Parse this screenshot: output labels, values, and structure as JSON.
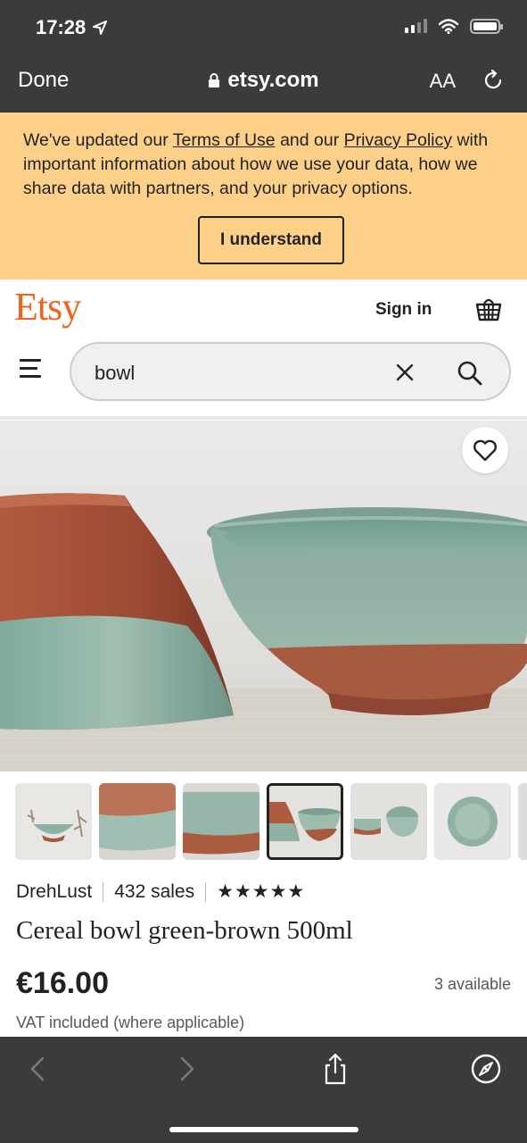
{
  "status_bar": {
    "time": "17:28"
  },
  "browser": {
    "done_label": "Done",
    "url": "etsy.com",
    "text_size_label": "AA",
    "colors": {
      "chrome": "#3b3b3d"
    }
  },
  "banner": {
    "text_before_terms": "We've updated our ",
    "terms_link": "Terms of Use",
    "text_between": " and our ",
    "privacy_link": "Privacy Policy",
    "text_after": " with important information about how we use your data, how we share data with partners, and your privacy options.",
    "button_label": "I understand",
    "colors": {
      "background": "#fdd08a"
    }
  },
  "header": {
    "logo": "Etsy",
    "sign_in_label": "Sign in",
    "colors": {
      "brand": "#f1641e"
    }
  },
  "search": {
    "value": "bowl"
  },
  "gallery": {
    "thumbnail_count": 6,
    "active_index": 3
  },
  "product": {
    "shop_name": "DrehLust",
    "sales": "432 sales",
    "rating_stars": "★★★★★",
    "rating": 5,
    "title": "Cereal bowl green-brown 500ml",
    "price": "€16.00",
    "availability": "3 available",
    "vat_note": "VAT included (where applicable)"
  },
  "icons": {
    "location": "location-arrow-icon",
    "lock": "lock-icon",
    "reload": "reload-icon",
    "basket": "basket-icon",
    "menu": "hamburger-menu-icon",
    "clear": "close-icon",
    "search": "search-icon",
    "favorite": "heart-icon",
    "back": "chevron-left-icon",
    "forward": "chevron-right-icon",
    "share": "share-icon",
    "compass": "compass-icon"
  }
}
